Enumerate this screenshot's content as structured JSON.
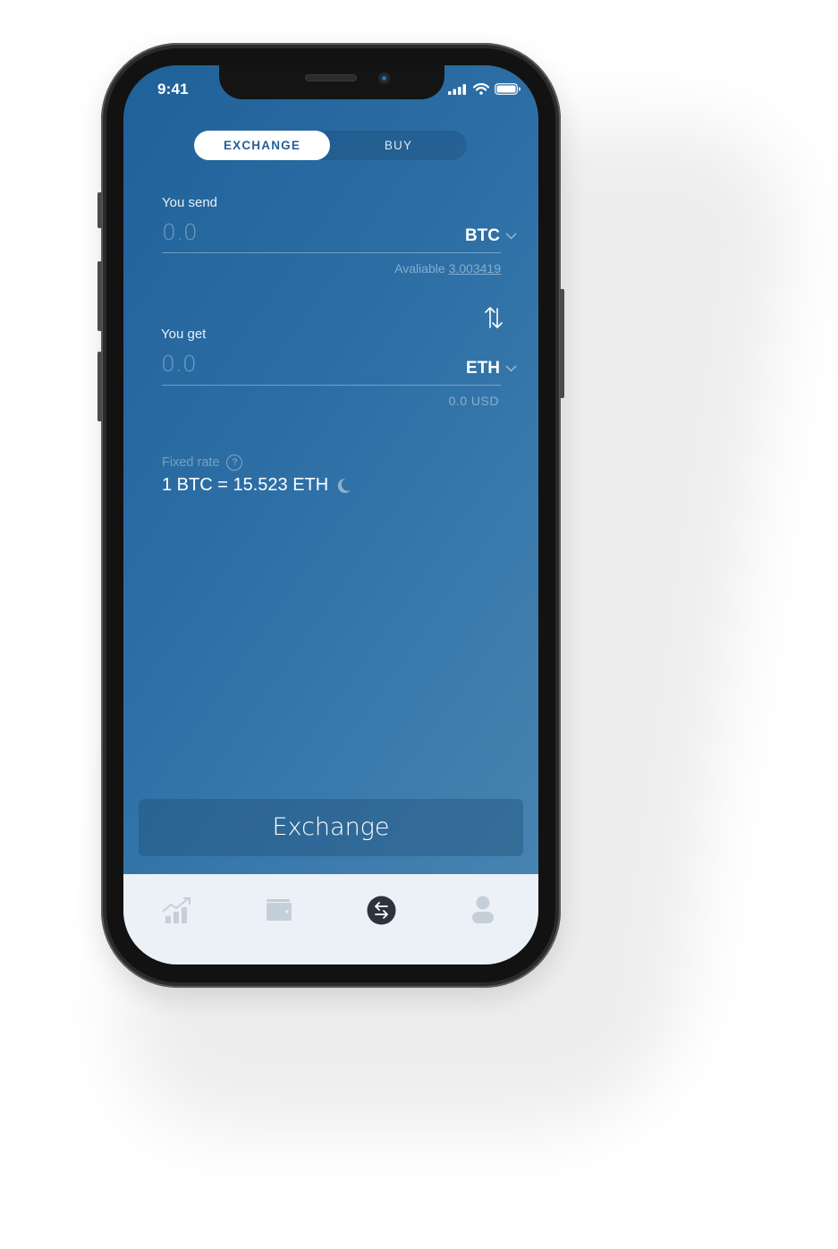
{
  "status_bar": {
    "time": "9:41",
    "icons": [
      "cellular-signal-icon",
      "wifi-icon",
      "battery-icon"
    ]
  },
  "segmented_control": {
    "options": [
      {
        "label": "EXCHANGE",
        "active": true
      },
      {
        "label": "BUY",
        "active": false
      }
    ]
  },
  "send": {
    "label": "You send",
    "placeholder": "0.0",
    "currency": "BTC",
    "available_label": "Avaliable",
    "available_value": "3.003419"
  },
  "get": {
    "label": "You get",
    "placeholder": "0.0",
    "currency": "ETH",
    "fiat_value": "0.0 USD"
  },
  "rate": {
    "label": "Fixed rate",
    "help": "?",
    "value": "1 BTC = 15.523 ETH"
  },
  "primary_action": {
    "label": "Exchange"
  },
  "tabbar": {
    "items": [
      {
        "name": "chart-growth-icon",
        "active": false
      },
      {
        "name": "wallet-icon",
        "active": false
      },
      {
        "name": "exchange-icon",
        "active": true
      },
      {
        "name": "profile-icon",
        "active": false
      }
    ]
  },
  "colors": {
    "gradient_start": "#1f6198",
    "gradient_end": "#4a86b3",
    "tabbar_bg": "#ecf1f7",
    "tab_inactive": "#c5cfd9",
    "tab_active": "#2b333c",
    "accent_text": "#22609a"
  }
}
